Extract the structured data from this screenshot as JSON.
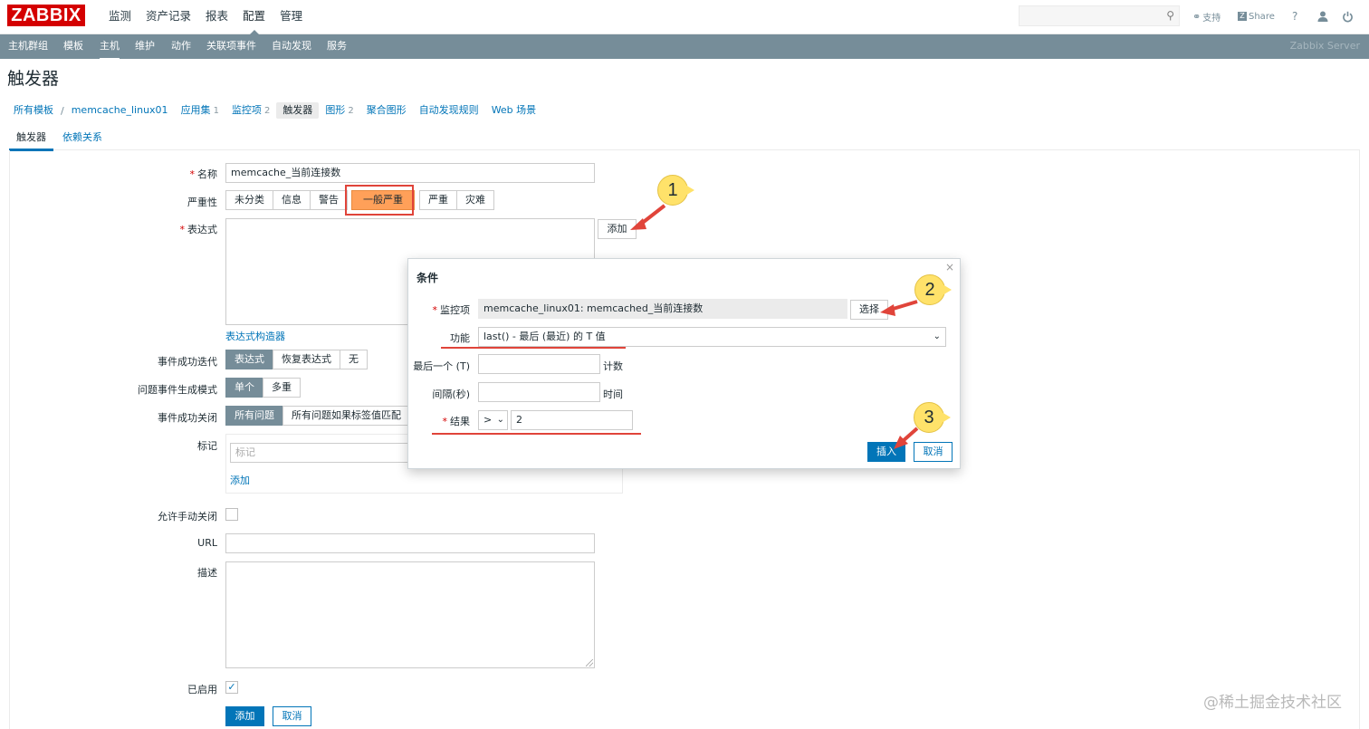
{
  "app": {
    "logo": "ZABBIX",
    "brand": "Zabbix Server"
  },
  "main_menu": [
    "监测",
    "资产记录",
    "报表",
    "配置",
    "管理"
  ],
  "toolbar_right": {
    "support": "支持",
    "share": "Share",
    "help": "?",
    "user_icon": "user-icon",
    "power_icon": "power-icon"
  },
  "sub_menu": [
    "主机群组",
    "模板",
    "主机",
    "维护",
    "动作",
    "关联项事件",
    "自动发现",
    "服务"
  ],
  "page_title": "触发器",
  "breadcrumb": {
    "all_templates": "所有模板",
    "separator": "/",
    "host": "memcache_linux01",
    "apps": "应用集",
    "apps_count": "1",
    "items": "监控项",
    "items_count": "2",
    "triggers": "触发器",
    "graphs": "图形",
    "graphs_count": "2",
    "screens": "聚合图形",
    "discovery": "自动发现规则",
    "web": "Web 场景"
  },
  "tabs": [
    "触发器",
    "依赖关系"
  ],
  "form": {
    "name_label": "名称",
    "name_value": "memcache_当前连接数",
    "severity_label": "严重性",
    "severity_options": [
      "未分类",
      "信息",
      "警告",
      "一般严重",
      "严重",
      "灾难"
    ],
    "severity_selected": "一般严重",
    "expression_label": "表达式",
    "add_button": "添加",
    "expression_builder": "表达式构造器",
    "ok_event_label": "事件成功迭代",
    "ok_event_options": [
      "表达式",
      "恢复表达式",
      "无"
    ],
    "problem_mode_label": "问题事件生成模式",
    "problem_mode_options": [
      "单个",
      "多重"
    ],
    "ok_close_label": "事件成功关闭",
    "ok_close_options": [
      "所有问题",
      "所有问题如果标签值匹配"
    ],
    "tags_label": "标记",
    "tags_placeholder": "标记",
    "tags_add": "添加",
    "manual_close_label": "允许手动关闭",
    "url_label": "URL",
    "desc_label": "描述",
    "enabled_label": "已启用",
    "enabled_checked": "✓",
    "submit": "添加",
    "cancel": "取消"
  },
  "dialog": {
    "title": "条件",
    "close": "×",
    "item_label": "监控项",
    "item_value": "memcache_linux01: memcached_当前连接数",
    "select_button": "选择",
    "function_label": "功能",
    "function_value": "last() - 最后 (最近) 的 T 值",
    "last_label": "最后一个 (T)",
    "last_unit": "计数",
    "interval_label": "间隔(秒)",
    "interval_unit": "时间",
    "result_label": "结果",
    "result_operator": ">",
    "result_value": "2",
    "insert": "插入",
    "cancel": "取消"
  },
  "annotations": [
    "1",
    "2",
    "3"
  ],
  "watermark": "@稀土掘金技术社区",
  "colors": {
    "brand_red": "#d40000",
    "nav_bar": "#768d99",
    "link_blue": "#0275b8",
    "severity_average": "#ffa059",
    "annotation_red": "#e0443a",
    "annotation_yellow": "#ffe26a"
  }
}
